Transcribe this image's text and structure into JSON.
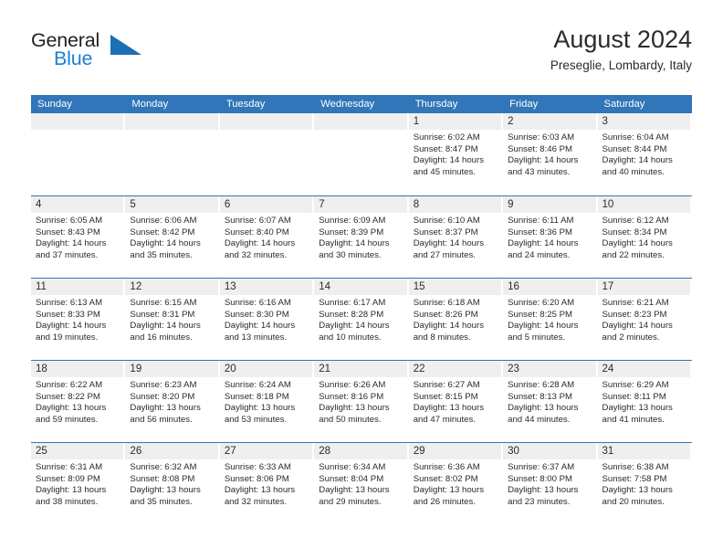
{
  "brand": {
    "name_part1": "General",
    "name_part2": "Blue",
    "accent_color": "#1b7fd4",
    "flag_icon": "blue-triangle-flag-icon"
  },
  "header": {
    "title": "August 2024",
    "subtitle": "Preseglie, Lombardy, Italy"
  },
  "colors": {
    "header_band": "#3076b8",
    "day_number_band": "#efefef",
    "text": "#2b2b2b",
    "header_text": "#ffffff"
  },
  "weekday_headers": [
    "Sunday",
    "Monday",
    "Tuesday",
    "Wednesday",
    "Thursday",
    "Friday",
    "Saturday"
  ],
  "weeks": [
    [
      {
        "day": "",
        "empty": true
      },
      {
        "day": "",
        "empty": true
      },
      {
        "day": "",
        "empty": true
      },
      {
        "day": "",
        "empty": true
      },
      {
        "day": "1",
        "sunrise": "Sunrise: 6:02 AM",
        "sunset": "Sunset: 8:47 PM",
        "daylight_1": "Daylight: 14 hours",
        "daylight_2": "and 45 minutes."
      },
      {
        "day": "2",
        "sunrise": "Sunrise: 6:03 AM",
        "sunset": "Sunset: 8:46 PM",
        "daylight_1": "Daylight: 14 hours",
        "daylight_2": "and 43 minutes."
      },
      {
        "day": "3",
        "sunrise": "Sunrise: 6:04 AM",
        "sunset": "Sunset: 8:44 PM",
        "daylight_1": "Daylight: 14 hours",
        "daylight_2": "and 40 minutes."
      }
    ],
    [
      {
        "day": "4",
        "sunrise": "Sunrise: 6:05 AM",
        "sunset": "Sunset: 8:43 PM",
        "daylight_1": "Daylight: 14 hours",
        "daylight_2": "and 37 minutes."
      },
      {
        "day": "5",
        "sunrise": "Sunrise: 6:06 AM",
        "sunset": "Sunset: 8:42 PM",
        "daylight_1": "Daylight: 14 hours",
        "daylight_2": "and 35 minutes."
      },
      {
        "day": "6",
        "sunrise": "Sunrise: 6:07 AM",
        "sunset": "Sunset: 8:40 PM",
        "daylight_1": "Daylight: 14 hours",
        "daylight_2": "and 32 minutes."
      },
      {
        "day": "7",
        "sunrise": "Sunrise: 6:09 AM",
        "sunset": "Sunset: 8:39 PM",
        "daylight_1": "Daylight: 14 hours",
        "daylight_2": "and 30 minutes."
      },
      {
        "day": "8",
        "sunrise": "Sunrise: 6:10 AM",
        "sunset": "Sunset: 8:37 PM",
        "daylight_1": "Daylight: 14 hours",
        "daylight_2": "and 27 minutes."
      },
      {
        "day": "9",
        "sunrise": "Sunrise: 6:11 AM",
        "sunset": "Sunset: 8:36 PM",
        "daylight_1": "Daylight: 14 hours",
        "daylight_2": "and 24 minutes."
      },
      {
        "day": "10",
        "sunrise": "Sunrise: 6:12 AM",
        "sunset": "Sunset: 8:34 PM",
        "daylight_1": "Daylight: 14 hours",
        "daylight_2": "and 22 minutes."
      }
    ],
    [
      {
        "day": "11",
        "sunrise": "Sunrise: 6:13 AM",
        "sunset": "Sunset: 8:33 PM",
        "daylight_1": "Daylight: 14 hours",
        "daylight_2": "and 19 minutes."
      },
      {
        "day": "12",
        "sunrise": "Sunrise: 6:15 AM",
        "sunset": "Sunset: 8:31 PM",
        "daylight_1": "Daylight: 14 hours",
        "daylight_2": "and 16 minutes."
      },
      {
        "day": "13",
        "sunrise": "Sunrise: 6:16 AM",
        "sunset": "Sunset: 8:30 PM",
        "daylight_1": "Daylight: 14 hours",
        "daylight_2": "and 13 minutes."
      },
      {
        "day": "14",
        "sunrise": "Sunrise: 6:17 AM",
        "sunset": "Sunset: 8:28 PM",
        "daylight_1": "Daylight: 14 hours",
        "daylight_2": "and 10 minutes."
      },
      {
        "day": "15",
        "sunrise": "Sunrise: 6:18 AM",
        "sunset": "Sunset: 8:26 PM",
        "daylight_1": "Daylight: 14 hours",
        "daylight_2": "and 8 minutes."
      },
      {
        "day": "16",
        "sunrise": "Sunrise: 6:20 AM",
        "sunset": "Sunset: 8:25 PM",
        "daylight_1": "Daylight: 14 hours",
        "daylight_2": "and 5 minutes."
      },
      {
        "day": "17",
        "sunrise": "Sunrise: 6:21 AM",
        "sunset": "Sunset: 8:23 PM",
        "daylight_1": "Daylight: 14 hours",
        "daylight_2": "and 2 minutes."
      }
    ],
    [
      {
        "day": "18",
        "sunrise": "Sunrise: 6:22 AM",
        "sunset": "Sunset: 8:22 PM",
        "daylight_1": "Daylight: 13 hours",
        "daylight_2": "and 59 minutes."
      },
      {
        "day": "19",
        "sunrise": "Sunrise: 6:23 AM",
        "sunset": "Sunset: 8:20 PM",
        "daylight_1": "Daylight: 13 hours",
        "daylight_2": "and 56 minutes."
      },
      {
        "day": "20",
        "sunrise": "Sunrise: 6:24 AM",
        "sunset": "Sunset: 8:18 PM",
        "daylight_1": "Daylight: 13 hours",
        "daylight_2": "and 53 minutes."
      },
      {
        "day": "21",
        "sunrise": "Sunrise: 6:26 AM",
        "sunset": "Sunset: 8:16 PM",
        "daylight_1": "Daylight: 13 hours",
        "daylight_2": "and 50 minutes."
      },
      {
        "day": "22",
        "sunrise": "Sunrise: 6:27 AM",
        "sunset": "Sunset: 8:15 PM",
        "daylight_1": "Daylight: 13 hours",
        "daylight_2": "and 47 minutes."
      },
      {
        "day": "23",
        "sunrise": "Sunrise: 6:28 AM",
        "sunset": "Sunset: 8:13 PM",
        "daylight_1": "Daylight: 13 hours",
        "daylight_2": "and 44 minutes."
      },
      {
        "day": "24",
        "sunrise": "Sunrise: 6:29 AM",
        "sunset": "Sunset: 8:11 PM",
        "daylight_1": "Daylight: 13 hours",
        "daylight_2": "and 41 minutes."
      }
    ],
    [
      {
        "day": "25",
        "sunrise": "Sunrise: 6:31 AM",
        "sunset": "Sunset: 8:09 PM",
        "daylight_1": "Daylight: 13 hours",
        "daylight_2": "and 38 minutes."
      },
      {
        "day": "26",
        "sunrise": "Sunrise: 6:32 AM",
        "sunset": "Sunset: 8:08 PM",
        "daylight_1": "Daylight: 13 hours",
        "daylight_2": "and 35 minutes."
      },
      {
        "day": "27",
        "sunrise": "Sunrise: 6:33 AM",
        "sunset": "Sunset: 8:06 PM",
        "daylight_1": "Daylight: 13 hours",
        "daylight_2": "and 32 minutes."
      },
      {
        "day": "28",
        "sunrise": "Sunrise: 6:34 AM",
        "sunset": "Sunset: 8:04 PM",
        "daylight_1": "Daylight: 13 hours",
        "daylight_2": "and 29 minutes."
      },
      {
        "day": "29",
        "sunrise": "Sunrise: 6:36 AM",
        "sunset": "Sunset: 8:02 PM",
        "daylight_1": "Daylight: 13 hours",
        "daylight_2": "and 26 minutes."
      },
      {
        "day": "30",
        "sunrise": "Sunrise: 6:37 AM",
        "sunset": "Sunset: 8:00 PM",
        "daylight_1": "Daylight: 13 hours",
        "daylight_2": "and 23 minutes."
      },
      {
        "day": "31",
        "sunrise": "Sunrise: 6:38 AM",
        "sunset": "Sunset: 7:58 PM",
        "daylight_1": "Daylight: 13 hours",
        "daylight_2": "and 20 minutes."
      }
    ]
  ]
}
